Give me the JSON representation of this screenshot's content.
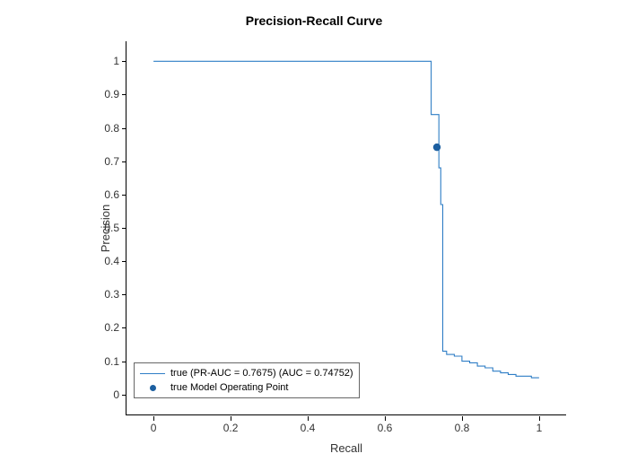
{
  "chart_data": {
    "type": "line",
    "title": "Precision-Recall Curve",
    "xlabel": "Recall",
    "ylabel": "Precision",
    "xlim": [
      -0.07,
      1.07
    ],
    "ylim": [
      -0.06,
      1.06
    ],
    "xticks": [
      0,
      0.2,
      0.4,
      0.6,
      0.8,
      1
    ],
    "yticks": [
      0,
      0.1,
      0.2,
      0.3,
      0.4,
      0.5,
      0.6,
      0.7,
      0.8,
      0.9,
      1
    ],
    "series": [
      {
        "name": "true (PR-AUC = 0.7675) (AUC = 0.74752)",
        "type": "line",
        "color": "#2f7ec6",
        "x": [
          0.0,
          0.02,
          0.68,
          0.72,
          0.72,
          0.74,
          0.74,
          0.745,
          0.745,
          0.75,
          0.75,
          0.76,
          0.76,
          0.78,
          0.78,
          0.8,
          0.8,
          0.82,
          0.82,
          0.84,
          0.84,
          0.86,
          0.86,
          0.88,
          0.88,
          0.9,
          0.9,
          0.92,
          0.92,
          0.94,
          0.94,
          0.96,
          0.96,
          0.98,
          0.98,
          1.0
        ],
        "y": [
          1.0,
          1.0,
          1.0,
          1.0,
          0.84,
          0.84,
          0.68,
          0.68,
          0.57,
          0.57,
          0.13,
          0.13,
          0.12,
          0.12,
          0.115,
          0.115,
          0.1,
          0.1,
          0.095,
          0.095,
          0.085,
          0.085,
          0.08,
          0.08,
          0.07,
          0.07,
          0.065,
          0.065,
          0.06,
          0.06,
          0.055,
          0.055,
          0.055,
          0.055,
          0.05,
          0.05
        ]
      },
      {
        "name": "true Model Operating Point",
        "type": "point",
        "color": "#1c5fa0",
        "x": [
          0.735
        ],
        "y": [
          0.742
        ]
      }
    ],
    "legend": {
      "entries": [
        "true (PR-AUC = 0.7675) (AUC = 0.74752)",
        "true Model Operating Point"
      ],
      "position": "lower"
    }
  }
}
